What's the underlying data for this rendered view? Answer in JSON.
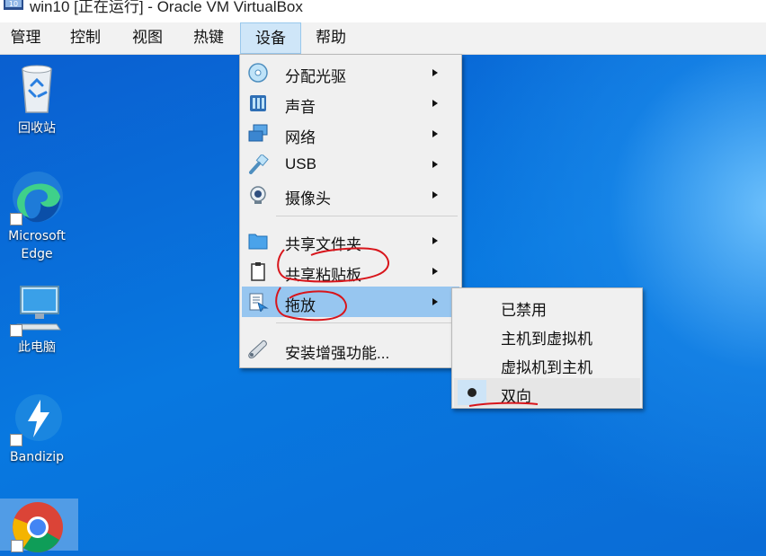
{
  "window": {
    "title": "win10 [正在运行] - Oracle VM VirtualBox",
    "icon_badge": "10"
  },
  "menubar": {
    "items": [
      {
        "label": "管理"
      },
      {
        "label": "控制"
      },
      {
        "label": "视图"
      },
      {
        "label": "热键"
      },
      {
        "label": "设备",
        "active": true
      },
      {
        "label": "帮助"
      }
    ]
  },
  "desktop": {
    "icons": [
      {
        "label": "回收站",
        "icon": "recycle-bin-icon"
      },
      {
        "label": "Microsoft Edge",
        "label_line1": "Microsoft",
        "label_line2": "Edge",
        "icon": "edge-icon"
      },
      {
        "label": "此电脑",
        "icon": "computer-icon"
      },
      {
        "label": "Bandizip",
        "icon": "bandizip-icon"
      },
      {
        "label": "",
        "icon": "chrome-icon"
      }
    ]
  },
  "devices_menu": {
    "items": [
      {
        "label": "分配光驱",
        "icon": "optical-disc-icon",
        "submenu": true
      },
      {
        "label": "声音",
        "icon": "audio-icon",
        "submenu": true
      },
      {
        "label": "网络",
        "icon": "network-icon",
        "submenu": true
      },
      {
        "label": "USB",
        "icon": "usb-icon",
        "submenu": true
      },
      {
        "label": "摄像头",
        "icon": "webcam-icon",
        "submenu": true
      },
      {
        "label": "共享文件夹",
        "icon": "shared-folder-icon",
        "submenu": true
      },
      {
        "label": "共享粘贴板",
        "icon": "clipboard-icon",
        "submenu": true
      },
      {
        "label": "拖放",
        "icon": "drag-drop-icon",
        "submenu": true,
        "highlighted": true
      },
      {
        "label": "安装增强功能...",
        "icon": "guest-additions-icon",
        "submenu": false
      }
    ]
  },
  "drag_drop_submenu": {
    "items": [
      {
        "label": "已禁用",
        "selected": false
      },
      {
        "label": "主机到虚拟机",
        "selected": false
      },
      {
        "label": "虚拟机到主机",
        "selected": false
      },
      {
        "label": "双向",
        "selected": true
      }
    ]
  },
  "colors": {
    "desktop_blue": "#0a6fd8",
    "menu_bg": "#f0f0f0",
    "menu_highlight": "#97c6f0",
    "menubar_active": "#cfe6f8",
    "annotation_red": "#d8151b"
  }
}
